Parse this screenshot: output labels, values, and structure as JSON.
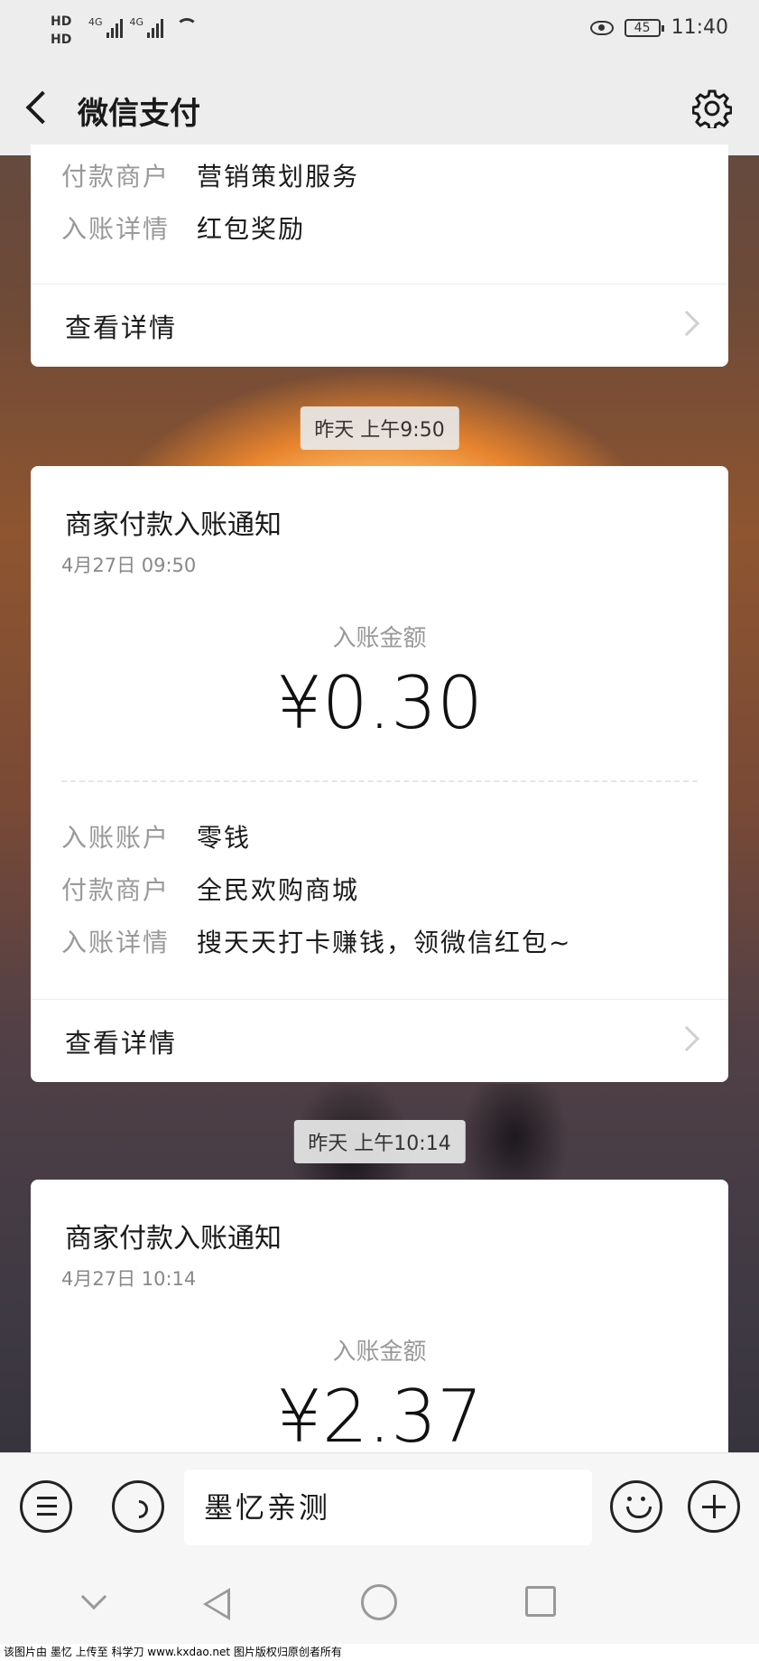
{
  "status_bar": {
    "hd1": "HD",
    "hd2": "HD",
    "net1": "4G",
    "net2": "4G",
    "battery": "45",
    "time": "11:40"
  },
  "nav": {
    "title": "微信支付"
  },
  "card0": {
    "rows": [
      {
        "k": "付款商户",
        "v": "营销策划服务"
      },
      {
        "k": "入账详情",
        "v": "红包奖励"
      }
    ],
    "detail_label": "查看详情"
  },
  "chip1": "昨天 上午9:50",
  "card1": {
    "title": "商家付款入账通知",
    "date": "4月27日 09:50",
    "amount_label": "入账金额",
    "amount": "¥0.30",
    "rows": [
      {
        "k": "入账账户",
        "v": "零钱"
      },
      {
        "k": "付款商户",
        "v": "全民欢购商城"
      },
      {
        "k": "入账详情",
        "v": "搜天天打卡赚钱，领微信红包~"
      }
    ],
    "detail_label": "查看详情"
  },
  "chip2": "昨天 上午10:14",
  "card2": {
    "title": "商家付款入账通知",
    "date": "4月27日 10:14",
    "amount_label": "入账金额",
    "amount": "¥2.37"
  },
  "input_bar": {
    "input_value": "墨忆亲测"
  },
  "watermark": "该图片由 墨忆 上传至 科学刀 www.kxdao.net 图片版权归原创者所有"
}
